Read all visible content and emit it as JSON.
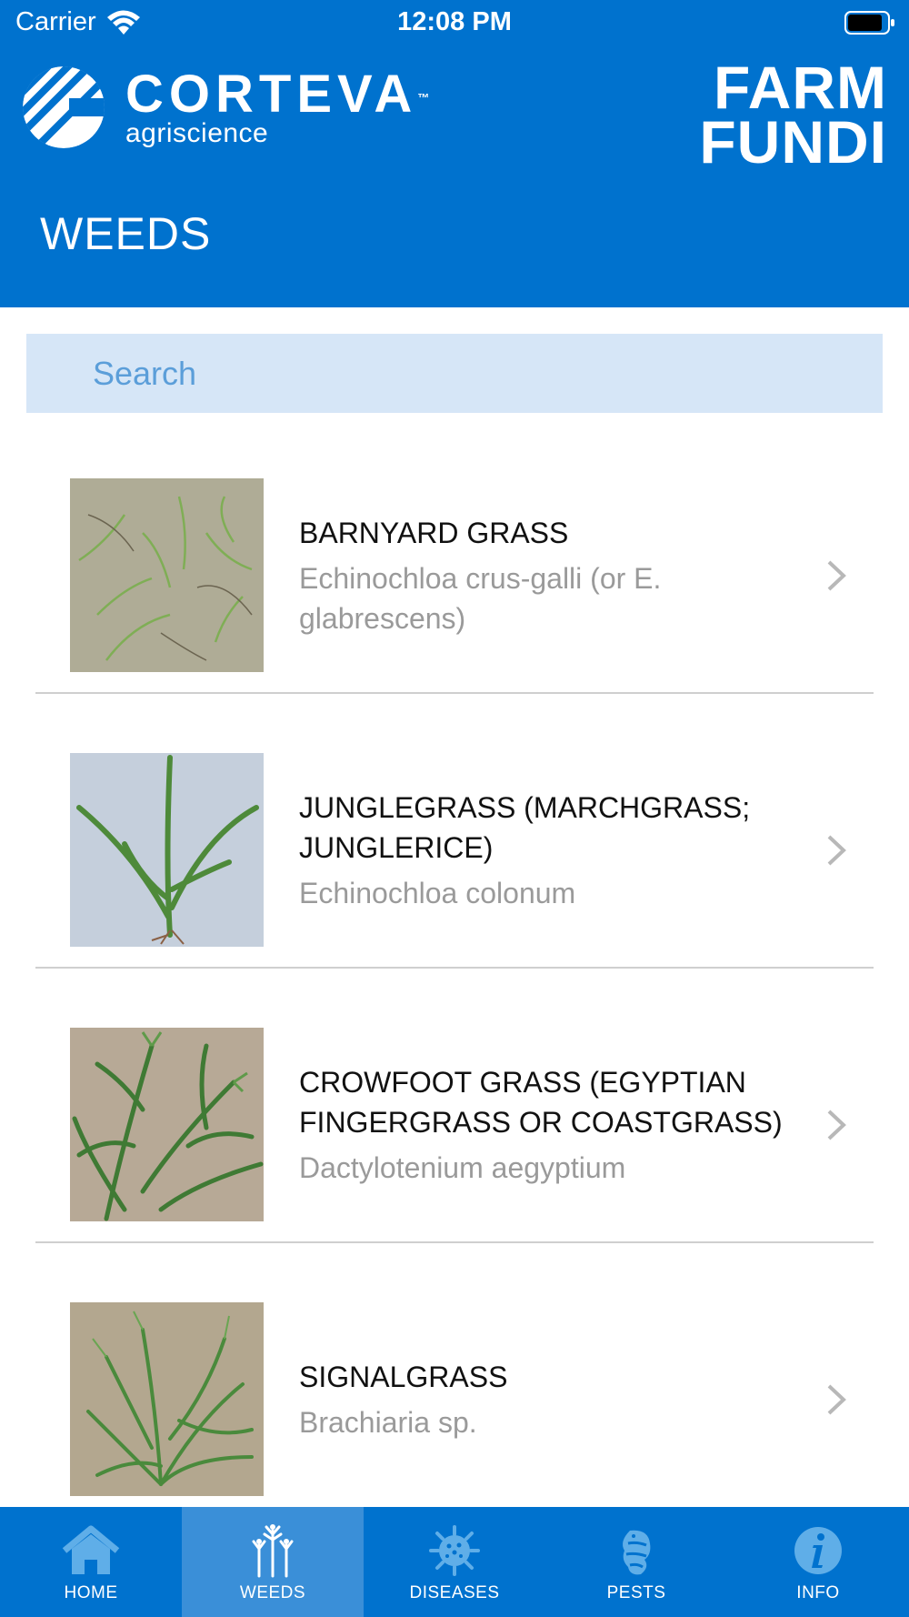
{
  "status_bar": {
    "carrier": "Carrier",
    "time": "12:08 PM"
  },
  "brand": {
    "name": "CORTEVA",
    "trademark": "™",
    "subtitle": "agriscience",
    "app_name_line1": "FARM",
    "app_name_line2": "FUNDI",
    "color": "#0072ce"
  },
  "page": {
    "title": "WEEDS"
  },
  "search": {
    "placeholder": "Search",
    "value": ""
  },
  "items": [
    {
      "title": "BARNYARD GRASS",
      "subtitle": "Echinochloa crus-galli (or E. glabrescens)",
      "image": "barnyard-grass-photo"
    },
    {
      "title": "JUNGLEGRASS (MARCHGRASS; JUNGLERICE)",
      "subtitle": "Echinochloa colonum",
      "image": "junglegrass-photo"
    },
    {
      "title": "CROWFOOT GRASS (EGYPTIAN FINGERGRASS OR COASTGRASS)",
      "subtitle": "Dactylotenium aegyptium",
      "image": "crowfoot-grass-photo"
    },
    {
      "title": "SIGNALGRASS",
      "subtitle": "Brachiaria sp.",
      "image": "signalgrass-photo"
    }
  ],
  "tabs": [
    {
      "label": "HOME",
      "icon": "home-icon",
      "active": false
    },
    {
      "label": "WEEDS",
      "icon": "weeds-icon",
      "active": true
    },
    {
      "label": "DISEASES",
      "icon": "diseases-icon",
      "active": false
    },
    {
      "label": "PESTS",
      "icon": "pests-icon",
      "active": false
    },
    {
      "label": "INFO",
      "icon": "info-icon",
      "active": false
    }
  ]
}
